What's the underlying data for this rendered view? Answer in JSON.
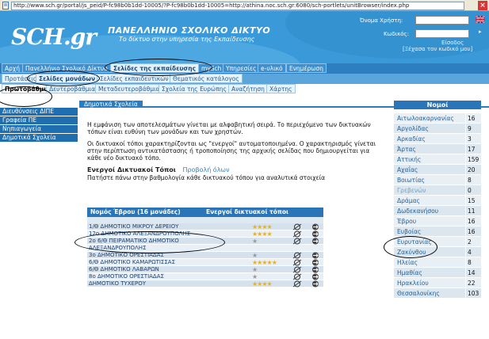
{
  "browser": {
    "url": "http://www.sch.gr/portal/js_peid/P-fc98b0b1dd-10005/?P-fc98b0b1dd-10005=http://athina.noc.sch.gr:6080/sch-portlets/unitBrowser/index.php"
  },
  "header": {
    "logo": "SCH.gr",
    "title": "ΠΑΝΕΛΛΗΝΙΟ ΣΧΟΛΙΚΟ ΔΙΚΤΥΟ",
    "subtitle": "Το δίκτυο στην υπηρεσία της Εκπαίδευσης",
    "username_label": "Όνομα Χρήστη:",
    "password_label": "Κωδικός:",
    "login_link": "Είσοδος",
    "forgot_link": "[Ξέχασα τον κωδικό μου]"
  },
  "nav1": [
    "Αρχή",
    "Πανελλήνιο Σχολικό Δίκτυο",
    "Σελίδες της εκπαίδευσης",
    "mySch",
    "Υπηρεσίες",
    "e-υλικό",
    "Ενημέρωση"
  ],
  "nav2": [
    "Προτάσεις",
    "Σελίδες μονάδων",
    "Σελίδες εκπαιδευτικών",
    "Θεματικός κατάλογος"
  ],
  "nav3": [
    "Πρωτοβάθμια",
    "Δευτεροβάθμια",
    "Μεταδευτεροβάθμια",
    "Σχολεία της Ευρώπης",
    "Αναζήτηση",
    "Χάρτης"
  ],
  "sidebar": [
    "Διευθύνσεις ΔΙΠΕ",
    "Γραφεία ΠΕ",
    "Νηπιαγωγεία",
    "Δημοτικά Σχολεία"
  ],
  "content": {
    "heading": "Δημοτικά Σχολεία",
    "p1": "Η εμφάνιση των αποτελεσμάτων γίνεται με αλφαβητική σειρά. Το περιεχόμενο των δικτυακών τόπων είναι ευθύνη των μονάδων και των χρηστών.",
    "p2": "Οι δικτυακοί τόποι χαρακτηρίζονται ως \"ενεργοί\" αυτοματοποιημένα. Ο χαρακτηρισμός γίνεται στην περίπτωση αντικατάστασης ή τροποποίησης της αρχικής σελίδας που δημιουργείται για κάθε νέο δικτυακό τόπο.",
    "active_title": "Ενεργοί Δικτυακοί Τόποι",
    "show_all": "Προβολή όλων",
    "instruction": "Πατήστε πάνω στην βαθμολογία κάθε δικτυακού τόπου για αναλυτικά στοιχεία"
  },
  "table": {
    "header_left": "Νομός Έβρου (16 μονάδες)",
    "header_right": "Ενεργοί δικτυακοί τόποι",
    "rows": [
      {
        "name": "1/Θ ΔΗΜΟΤΙΚΟ ΜΙΚΡΟΥ ΔΕΡΕΙΟΥ",
        "stars": "★★★★",
        "grey": false
      },
      {
        "name": "12ο ΔΗΜΟΤΙΚΟ ΑΛΕΞΑΝΔΡΟΥΠΟΛΗΣ",
        "stars": "★★★★",
        "grey": false
      },
      {
        "name": "2ο 6/Θ ΠΕΙΡΑΜΑΤΙΚΟ ΔΗΜΟΤΙΚΟ",
        "stars": "★",
        "grey": true
      },
      {
        "name": "ΑΛΕΞΑΝΔΡΟΥΠΟΛΗΣ",
        "stars": "",
        "grey": true
      },
      {
        "name": "3ο ΔΗΜΟΤΙΚΟ ΟΡΕΣΤΙΑΔΑΣ",
        "stars": "★",
        "grey": true
      },
      {
        "name": "6/Θ ΔΗΜΟΤΙΚΟ ΚΑΜΑΡΩΤΙΣΣΑΣ",
        "stars": "★★★★★",
        "grey": false
      },
      {
        "name": "6/Θ ΔΗΜΟΤΙΚΟ ΛΑΒΑΡΩΝ",
        "stars": "★",
        "grey": true
      },
      {
        "name": "8ο ΔΗΜΟΤΙΚΟ ΟΡΕΣΤΙΑΔΑΣ",
        "stars": "★",
        "grey": true
      },
      {
        "name": "ΔΗΜΟΤΙΚΟ ΤΥΧΕΡΟΥ",
        "stars": "★★★★",
        "grey": false
      }
    ]
  },
  "prefectures": {
    "title": "Νομοί",
    "rows": [
      {
        "name": "Αιτωλοακαρνανίας",
        "count": "16",
        "dim": false
      },
      {
        "name": "Αργολίδας",
        "count": "9",
        "dim": false
      },
      {
        "name": "Αρκαδίας",
        "count": "3",
        "dim": false
      },
      {
        "name": "Άρτας",
        "count": "17",
        "dim": false
      },
      {
        "name": "Αττικής",
        "count": "159",
        "dim": false
      },
      {
        "name": "Αχαΐας",
        "count": "20",
        "dim": false
      },
      {
        "name": "Βοιωτίας",
        "count": "8",
        "dim": false
      },
      {
        "name": "Γρεβενών",
        "count": "0",
        "dim": true
      },
      {
        "name": "Δράμας",
        "count": "15",
        "dim": false
      },
      {
        "name": "Δωδεκανήσου",
        "count": "11",
        "dim": false
      },
      {
        "name": "Έβρου",
        "count": "16",
        "dim": false
      },
      {
        "name": "Ευβοίας",
        "count": "16",
        "dim": false
      },
      {
        "name": "Ευρυτανίας",
        "count": "2",
        "dim": false
      },
      {
        "name": "Ζακύνθου",
        "count": "4",
        "dim": false
      },
      {
        "name": "Ηλείας",
        "count": "8",
        "dim": false
      },
      {
        "name": "Ημαθίας",
        "count": "14",
        "dim": false
      },
      {
        "name": "Ηρακλείου",
        "count": "22",
        "dim": false
      },
      {
        "name": "Θεσσαλονίκης",
        "count": "103",
        "dim": false
      }
    ]
  }
}
